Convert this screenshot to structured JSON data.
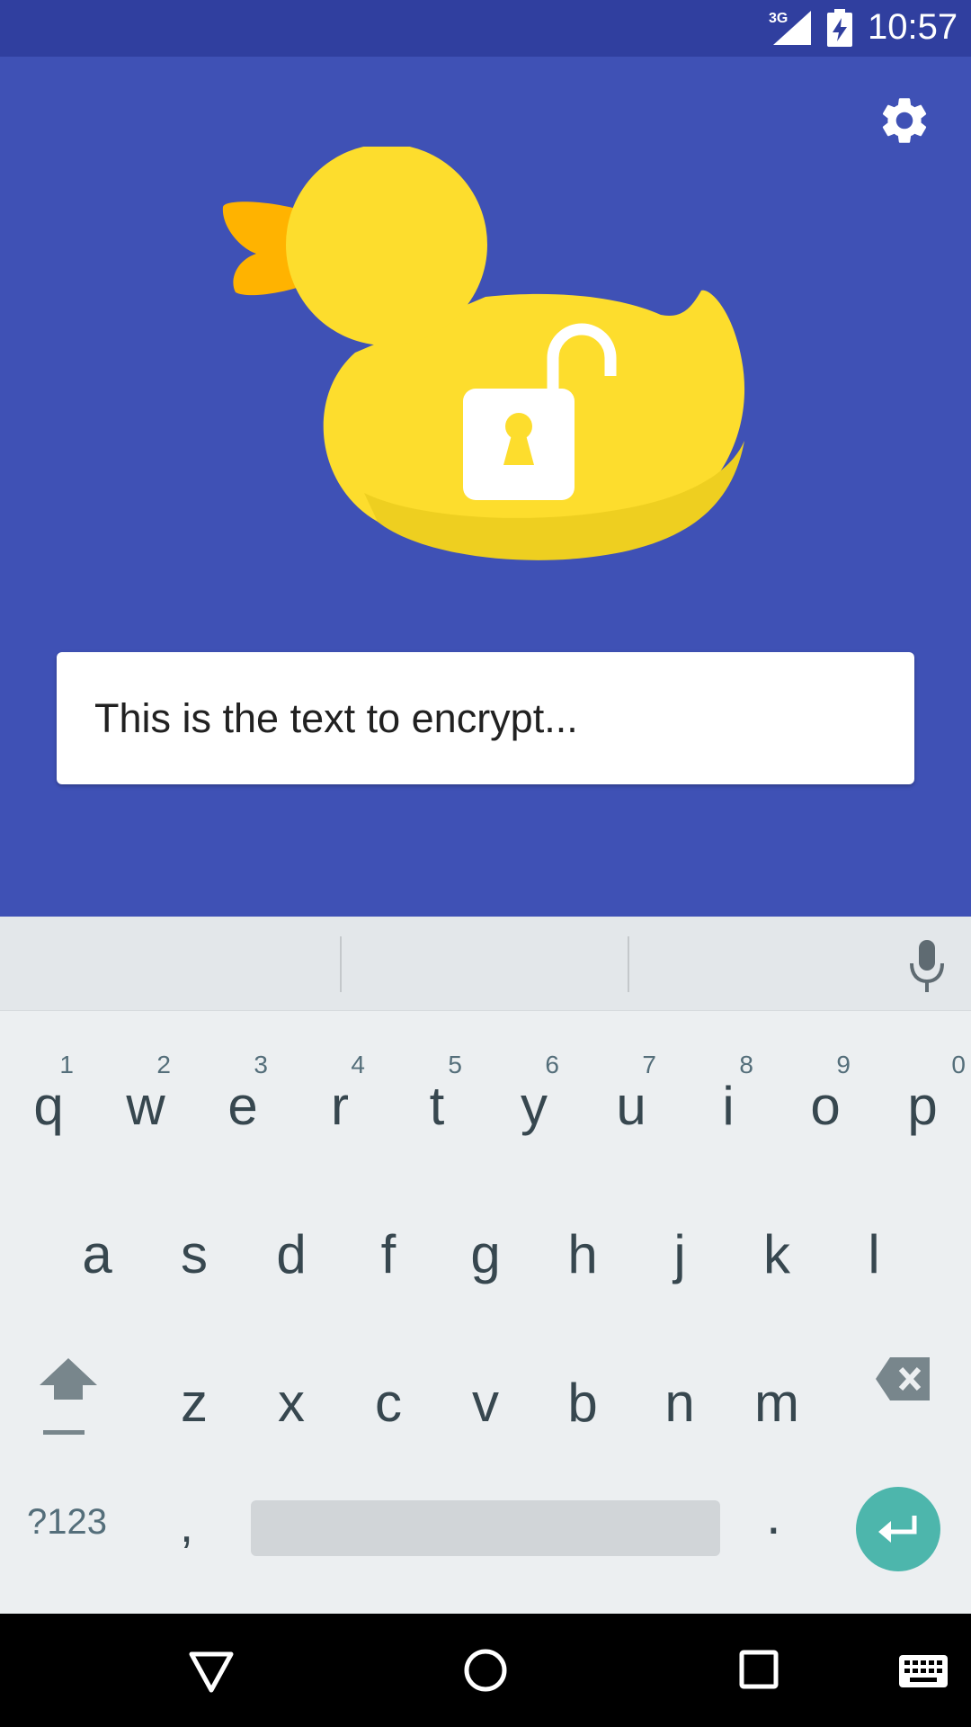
{
  "status_bar": {
    "network": "3G",
    "time": "10:57"
  },
  "main": {
    "input_text": "This is the text to encrypt...",
    "icons": {
      "settings": "gear-icon",
      "hero": "duck-unlock-illustration"
    }
  },
  "keyboard": {
    "row1": [
      {
        "char": "q",
        "num": "1"
      },
      {
        "char": "w",
        "num": "2"
      },
      {
        "char": "e",
        "num": "3"
      },
      {
        "char": "r",
        "num": "4"
      },
      {
        "char": "t",
        "num": "5"
      },
      {
        "char": "y",
        "num": "6"
      },
      {
        "char": "u",
        "num": "7"
      },
      {
        "char": "i",
        "num": "8"
      },
      {
        "char": "o",
        "num": "9"
      },
      {
        "char": "p",
        "num": "0"
      }
    ],
    "row2": [
      "a",
      "s",
      "d",
      "f",
      "g",
      "h",
      "j",
      "k",
      "l"
    ],
    "row3": [
      "z",
      "x",
      "c",
      "v",
      "b",
      "n",
      "m"
    ],
    "symbols_label": "?123",
    "comma": ",",
    "period": "."
  },
  "colors": {
    "primary": "#3F51B5",
    "primary_dark": "#303F9F",
    "accent_enter": "#4DB6AC",
    "duck_yellow": "#FDDD2D",
    "beak_orange": "#FFB300"
  }
}
